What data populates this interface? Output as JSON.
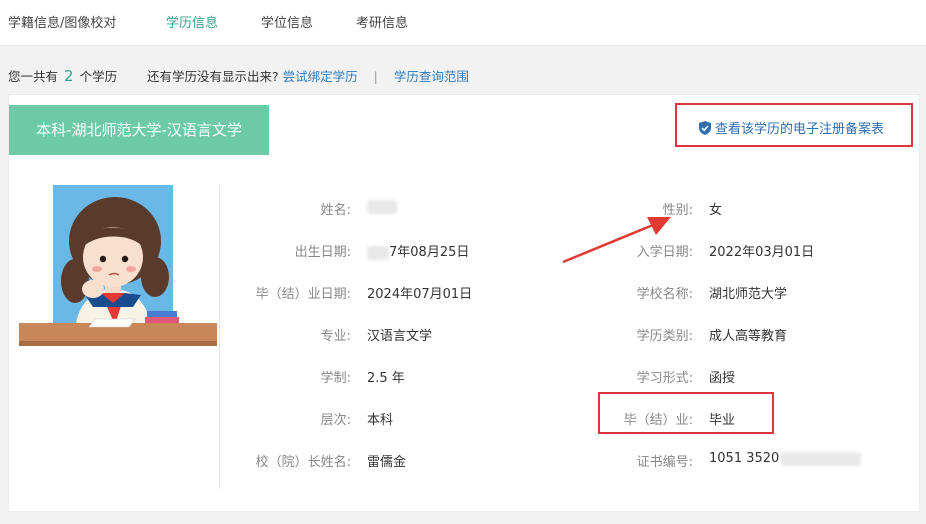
{
  "nav": {
    "tabs": [
      {
        "label": "学籍信息/图像校对",
        "active": false
      },
      {
        "label": "学历信息",
        "active": true
      },
      {
        "label": "学位信息",
        "active": false
      },
      {
        "label": "考研信息",
        "active": false
      }
    ]
  },
  "summary": {
    "prefix": "您一共有",
    "count": "2",
    "suffix": "个学历",
    "question": "还有学历没有显示出来?",
    "bind_link": "尝试绑定学历",
    "separator": "|",
    "scope_link": "学历查询范围"
  },
  "card": {
    "degree_title": "本科-湖北师范大学-汉语言文学",
    "registration_link": "查看该学历的电子注册备案表",
    "fields_left": [
      {
        "label": "姓名:",
        "value": ""
      },
      {
        "label": "出生日期:",
        "value": "7年08月25日"
      },
      {
        "label": "毕（结）业日期:",
        "value": "2024年07月01日"
      },
      {
        "label": "专业:",
        "value": "汉语言文学"
      },
      {
        "label": "学制:",
        "value": "2.5 年"
      },
      {
        "label": "层次:",
        "value": "本科"
      },
      {
        "label": "校（院）长姓名:",
        "value": "雷儒金"
      }
    ],
    "fields_right": [
      {
        "label": "性别:",
        "value": "女"
      },
      {
        "label": "入学日期:",
        "value": "2022年03月01日"
      },
      {
        "label": "学校名称:",
        "value": "湖北师范大学"
      },
      {
        "label": "学历类别:",
        "value": "成人高等教育"
      },
      {
        "label": "学习形式:",
        "value": "函授"
      },
      {
        "label": "毕（结）业:",
        "value": "毕业"
      },
      {
        "label": "证书编号:",
        "value": "1051 3520"
      }
    ]
  },
  "colors": {
    "accent": "#35a28c",
    "banner": "#6dcaa7",
    "link": "#2f7bbd",
    "highlight": "#d9363e"
  }
}
